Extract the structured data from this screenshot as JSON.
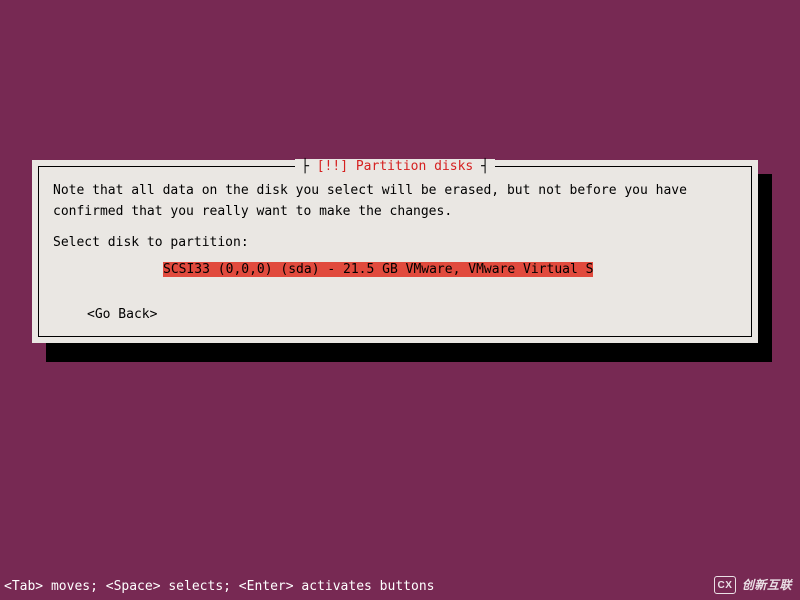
{
  "dialog": {
    "title_prefix": "[!!]",
    "title_text": "Partition disks",
    "body_line1": "Note that all data on the disk you select will be erased, but not before you have",
    "body_line2": "confirmed that you really want to make the changes.",
    "prompt": "Select disk to partition:",
    "disk_option": "SCSI33 (0,0,0) (sda) - 21.5 GB VMware, VMware Virtual S",
    "go_back": "<Go Back>"
  },
  "footer": {
    "help": "<Tab> moves; <Space> selects; <Enter> activates buttons"
  },
  "watermark": {
    "logo": "CX",
    "text": "创新互联"
  }
}
